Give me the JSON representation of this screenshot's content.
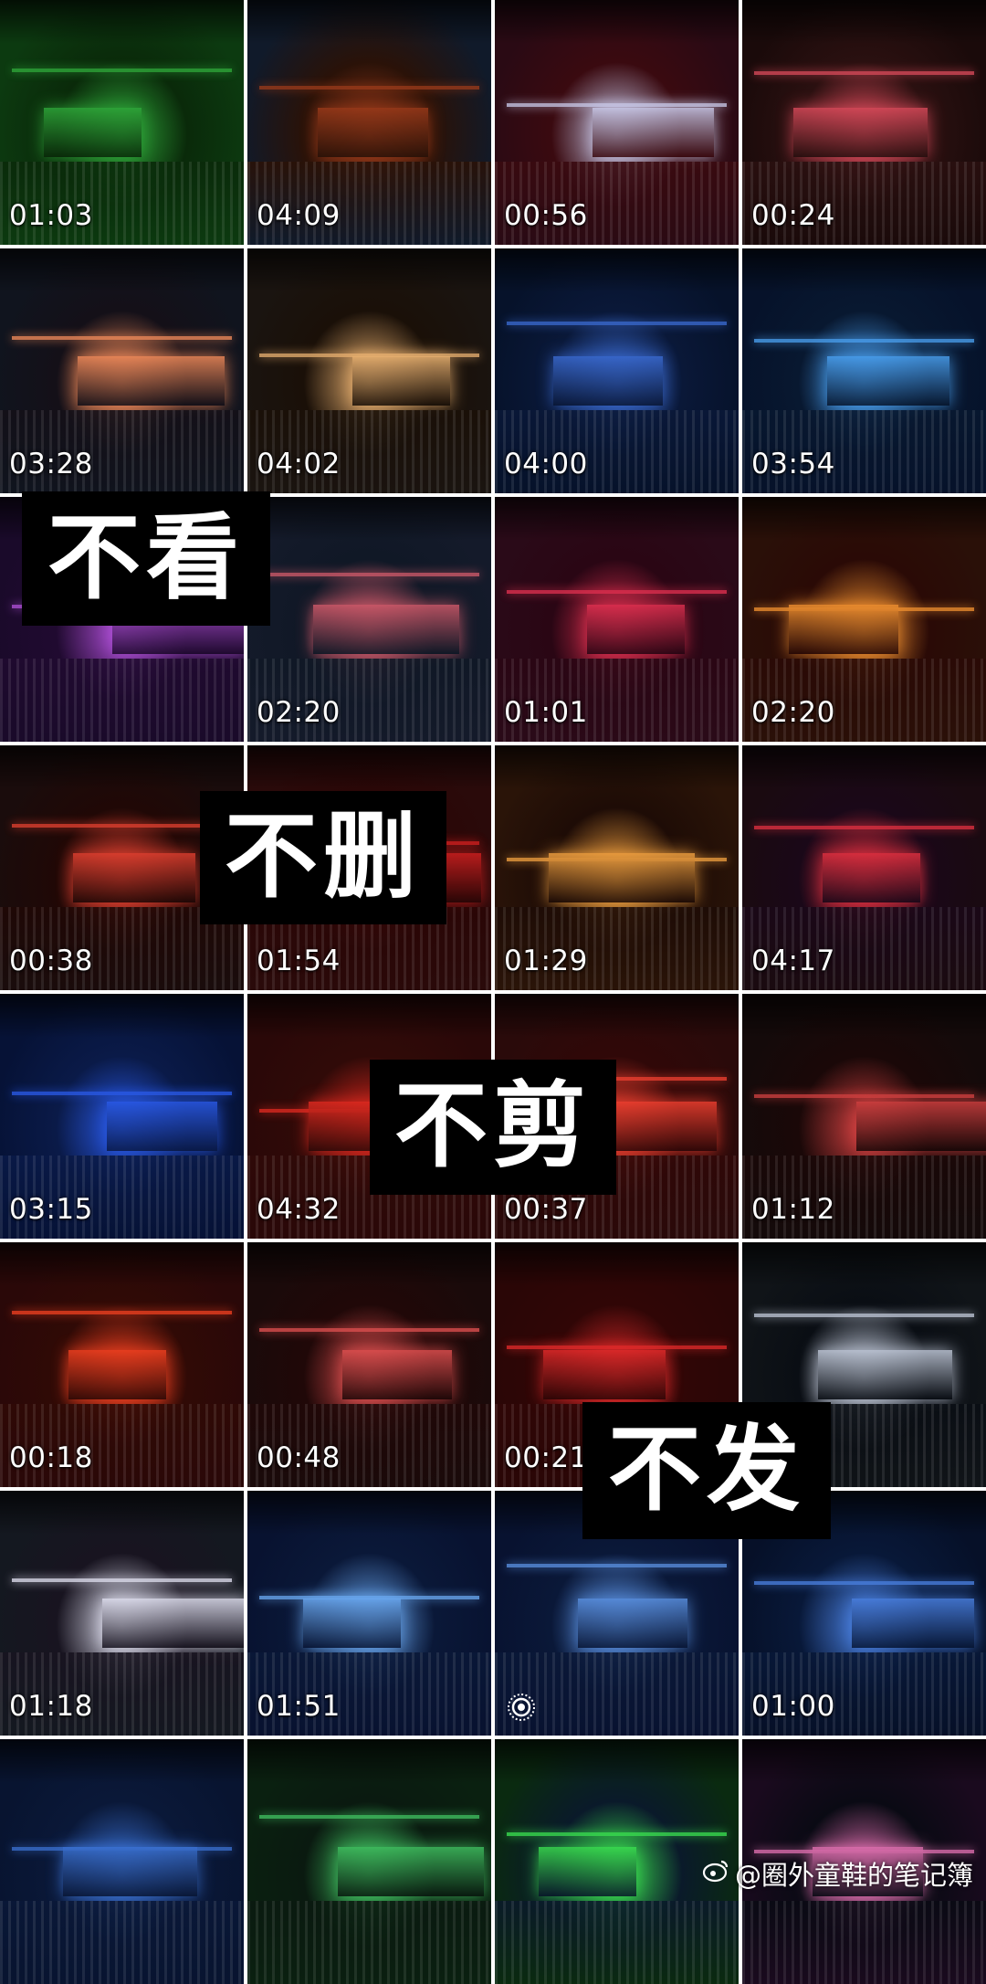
{
  "grid": {
    "columns": 4,
    "rows": 8,
    "tiles": [
      {
        "duration": "01:03",
        "theme": [
          "#0c3a10",
          "#2fa83a",
          "#0a2a0a"
        ]
      },
      {
        "duration": "04:09",
        "theme": [
          "#101a2a",
          "#9a3a1a",
          "#2a1208"
        ]
      },
      {
        "duration": "00:56",
        "theme": [
          "#2a0a14",
          "#c8c8e8",
          "#3a0a10"
        ]
      },
      {
        "duration": "00:24",
        "theme": [
          "#1a0a0a",
          "#d84a5a",
          "#2a1010"
        ]
      },
      {
        "duration": "03:28",
        "theme": [
          "#10141e",
          "#f08a5a",
          "#141018"
        ]
      },
      {
        "duration": "04:02",
        "theme": [
          "#1a1410",
          "#e8b070",
          "#1a1008"
        ]
      },
      {
        "duration": "04:00",
        "theme": [
          "#06122a",
          "#3a6ad0",
          "#0a1838"
        ]
      },
      {
        "duration": "03:54",
        "theme": [
          "#06122a",
          "#4aa0f0",
          "#081830"
        ]
      },
      {
        "duration": "",
        "theme": [
          "#1a0a2a",
          "#b050d8",
          "#200a30"
        ]
      },
      {
        "duration": "02:20",
        "theme": [
          "#141a2a",
          "#d05a6a",
          "#101826"
        ]
      },
      {
        "duration": "01:01",
        "theme": [
          "#2a0a18",
          "#e03050",
          "#2a0614"
        ]
      },
      {
        "duration": "02:20",
        "theme": [
          "#2a1008",
          "#f09030",
          "#2a0a06"
        ]
      },
      {
        "duration": "00:38",
        "theme": [
          "#1a0c0c",
          "#e04030",
          "#200806"
        ]
      },
      {
        "duration": "01:54",
        "theme": [
          "#2a0a0a",
          "#d02020",
          "#2a0606"
        ]
      },
      {
        "duration": "01:29",
        "theme": [
          "#2a1408",
          "#f0a040",
          "#1e0c06"
        ]
      },
      {
        "duration": "04:17",
        "theme": [
          "#1a0a10",
          "#e03040",
          "#1a0818"
        ]
      },
      {
        "duration": "03:15",
        "theme": [
          "#061236",
          "#2a5ae8",
          "#0a1a48"
        ]
      },
      {
        "duration": "04:32",
        "theme": [
          "#2a0808",
          "#e02a20",
          "#300a08"
        ]
      },
      {
        "duration": "00:37",
        "theme": [
          "#2a0a0a",
          "#f04030",
          "#300808"
        ]
      },
      {
        "duration": "01:12",
        "theme": [
          "#140a0a",
          "#d04040",
          "#1a0808"
        ]
      },
      {
        "duration": "00:18",
        "theme": [
          "#2a0808",
          "#f04020",
          "#300a06"
        ]
      },
      {
        "duration": "00:48",
        "theme": [
          "#1a0a0a",
          "#e05050",
          "#200808"
        ]
      },
      {
        "duration": "00:21",
        "theme": [
          "#2a0606",
          "#e02a2a",
          "#300606"
        ]
      },
      {
        "duration": "",
        "theme": [
          "#101418",
          "#c0c8d8",
          "#0a0e14"
        ]
      },
      {
        "duration": "01:18",
        "theme": [
          "#141820",
          "#e0e0f0",
          "#181420"
        ]
      },
      {
        "duration": "01:51",
        "theme": [
          "#081230",
          "#6aa8f0",
          "#0a1838"
        ]
      },
      {
        "duration": "",
        "theme": [
          "#081230",
          "#5a90e0",
          "#0a1838"
        ]
      },
      {
        "duration": "01:00",
        "theme": [
          "#061028",
          "#4a80e0",
          "#081838"
        ]
      },
      {
        "duration": "",
        "theme": [
          "#081430",
          "#3a70d0",
          "#0a1838"
        ]
      },
      {
        "duration": "",
        "theme": [
          "#0a2010",
          "#40c060",
          "#0a1a10"
        ]
      },
      {
        "duration": "",
        "theme": [
          "#0a2a10",
          "#3ae050",
          "#0a1a2a"
        ]
      },
      {
        "duration": "",
        "theme": [
          "#1a0a1e",
          "#e070b0",
          "#0a0a14"
        ]
      }
    ]
  },
  "captions": {
    "c1": "不看",
    "c2": "不删",
    "c3": "不剪",
    "c4": "不发"
  },
  "watermark": {
    "text": "@圈外童鞋的笔记簿"
  },
  "colors": {
    "grid_gap": "#ffffff",
    "caption_bg": "#000000",
    "caption_text": "#ffffff"
  },
  "icons": {
    "live_photo": "live-photo-icon",
    "weibo": "weibo-icon"
  }
}
